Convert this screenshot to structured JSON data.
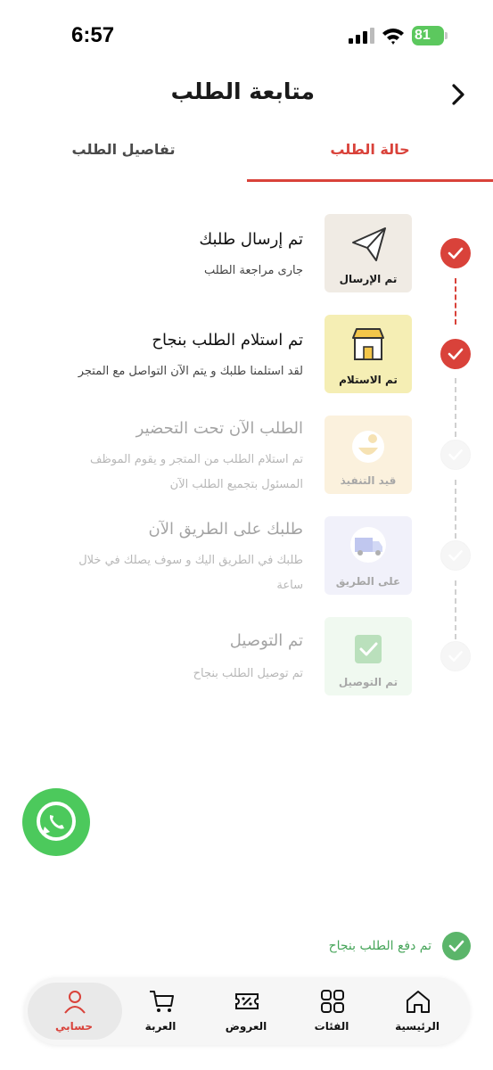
{
  "status_bar": {
    "time": "6:57",
    "battery": "81"
  },
  "header": {
    "title": "متابعة الطلب"
  },
  "tabs": [
    {
      "label": "حالة الطلب",
      "active": true
    },
    {
      "label": "تفاصيل الطلب",
      "active": false
    }
  ],
  "steps": [
    {
      "title": "تم إرسال طلبك",
      "description": "جارى مراجعة الطلب",
      "card_label": "تم الإرسال",
      "icon": "paper-plane-icon",
      "done": true
    },
    {
      "title": "تم استلام الطلب بنجاح",
      "description": "لقد استلمنا طلبك و يتم الآن التواصل مع المتجر",
      "card_label": "تم الاستلام",
      "icon": "store-icon",
      "done": true
    },
    {
      "title": "الطلب الآن تحت التحضير",
      "description": "تم استلام الطلب من المتجر و يقوم الموظف المسئول بتجميع الطلب الآن",
      "card_label": "قيد التنفيذ",
      "icon": "preparing-icon",
      "done": false
    },
    {
      "title": "طلبك على الطريق الآن",
      "description": "طلبك في الطريق اليك و سوف يصلك في خلال ساعة",
      "card_label": "على الطريق",
      "icon": "truck-icon",
      "done": false
    },
    {
      "title": "تم التوصيل",
      "description": "تم توصيل الطلب بنجاح",
      "card_label": "تم التوصيل",
      "icon": "delivered-bag-icon",
      "done": false
    }
  ],
  "payment": {
    "text": "تم دفع الطلب بنجاح"
  },
  "nav": {
    "home": "الرئيسية",
    "categories": "الفئات",
    "offers": "العروض",
    "cart": "العربة",
    "account": "حسابي"
  },
  "colors": {
    "accent": "#d9423a",
    "success": "#5bb56a",
    "whatsapp": "#4cc95c"
  }
}
